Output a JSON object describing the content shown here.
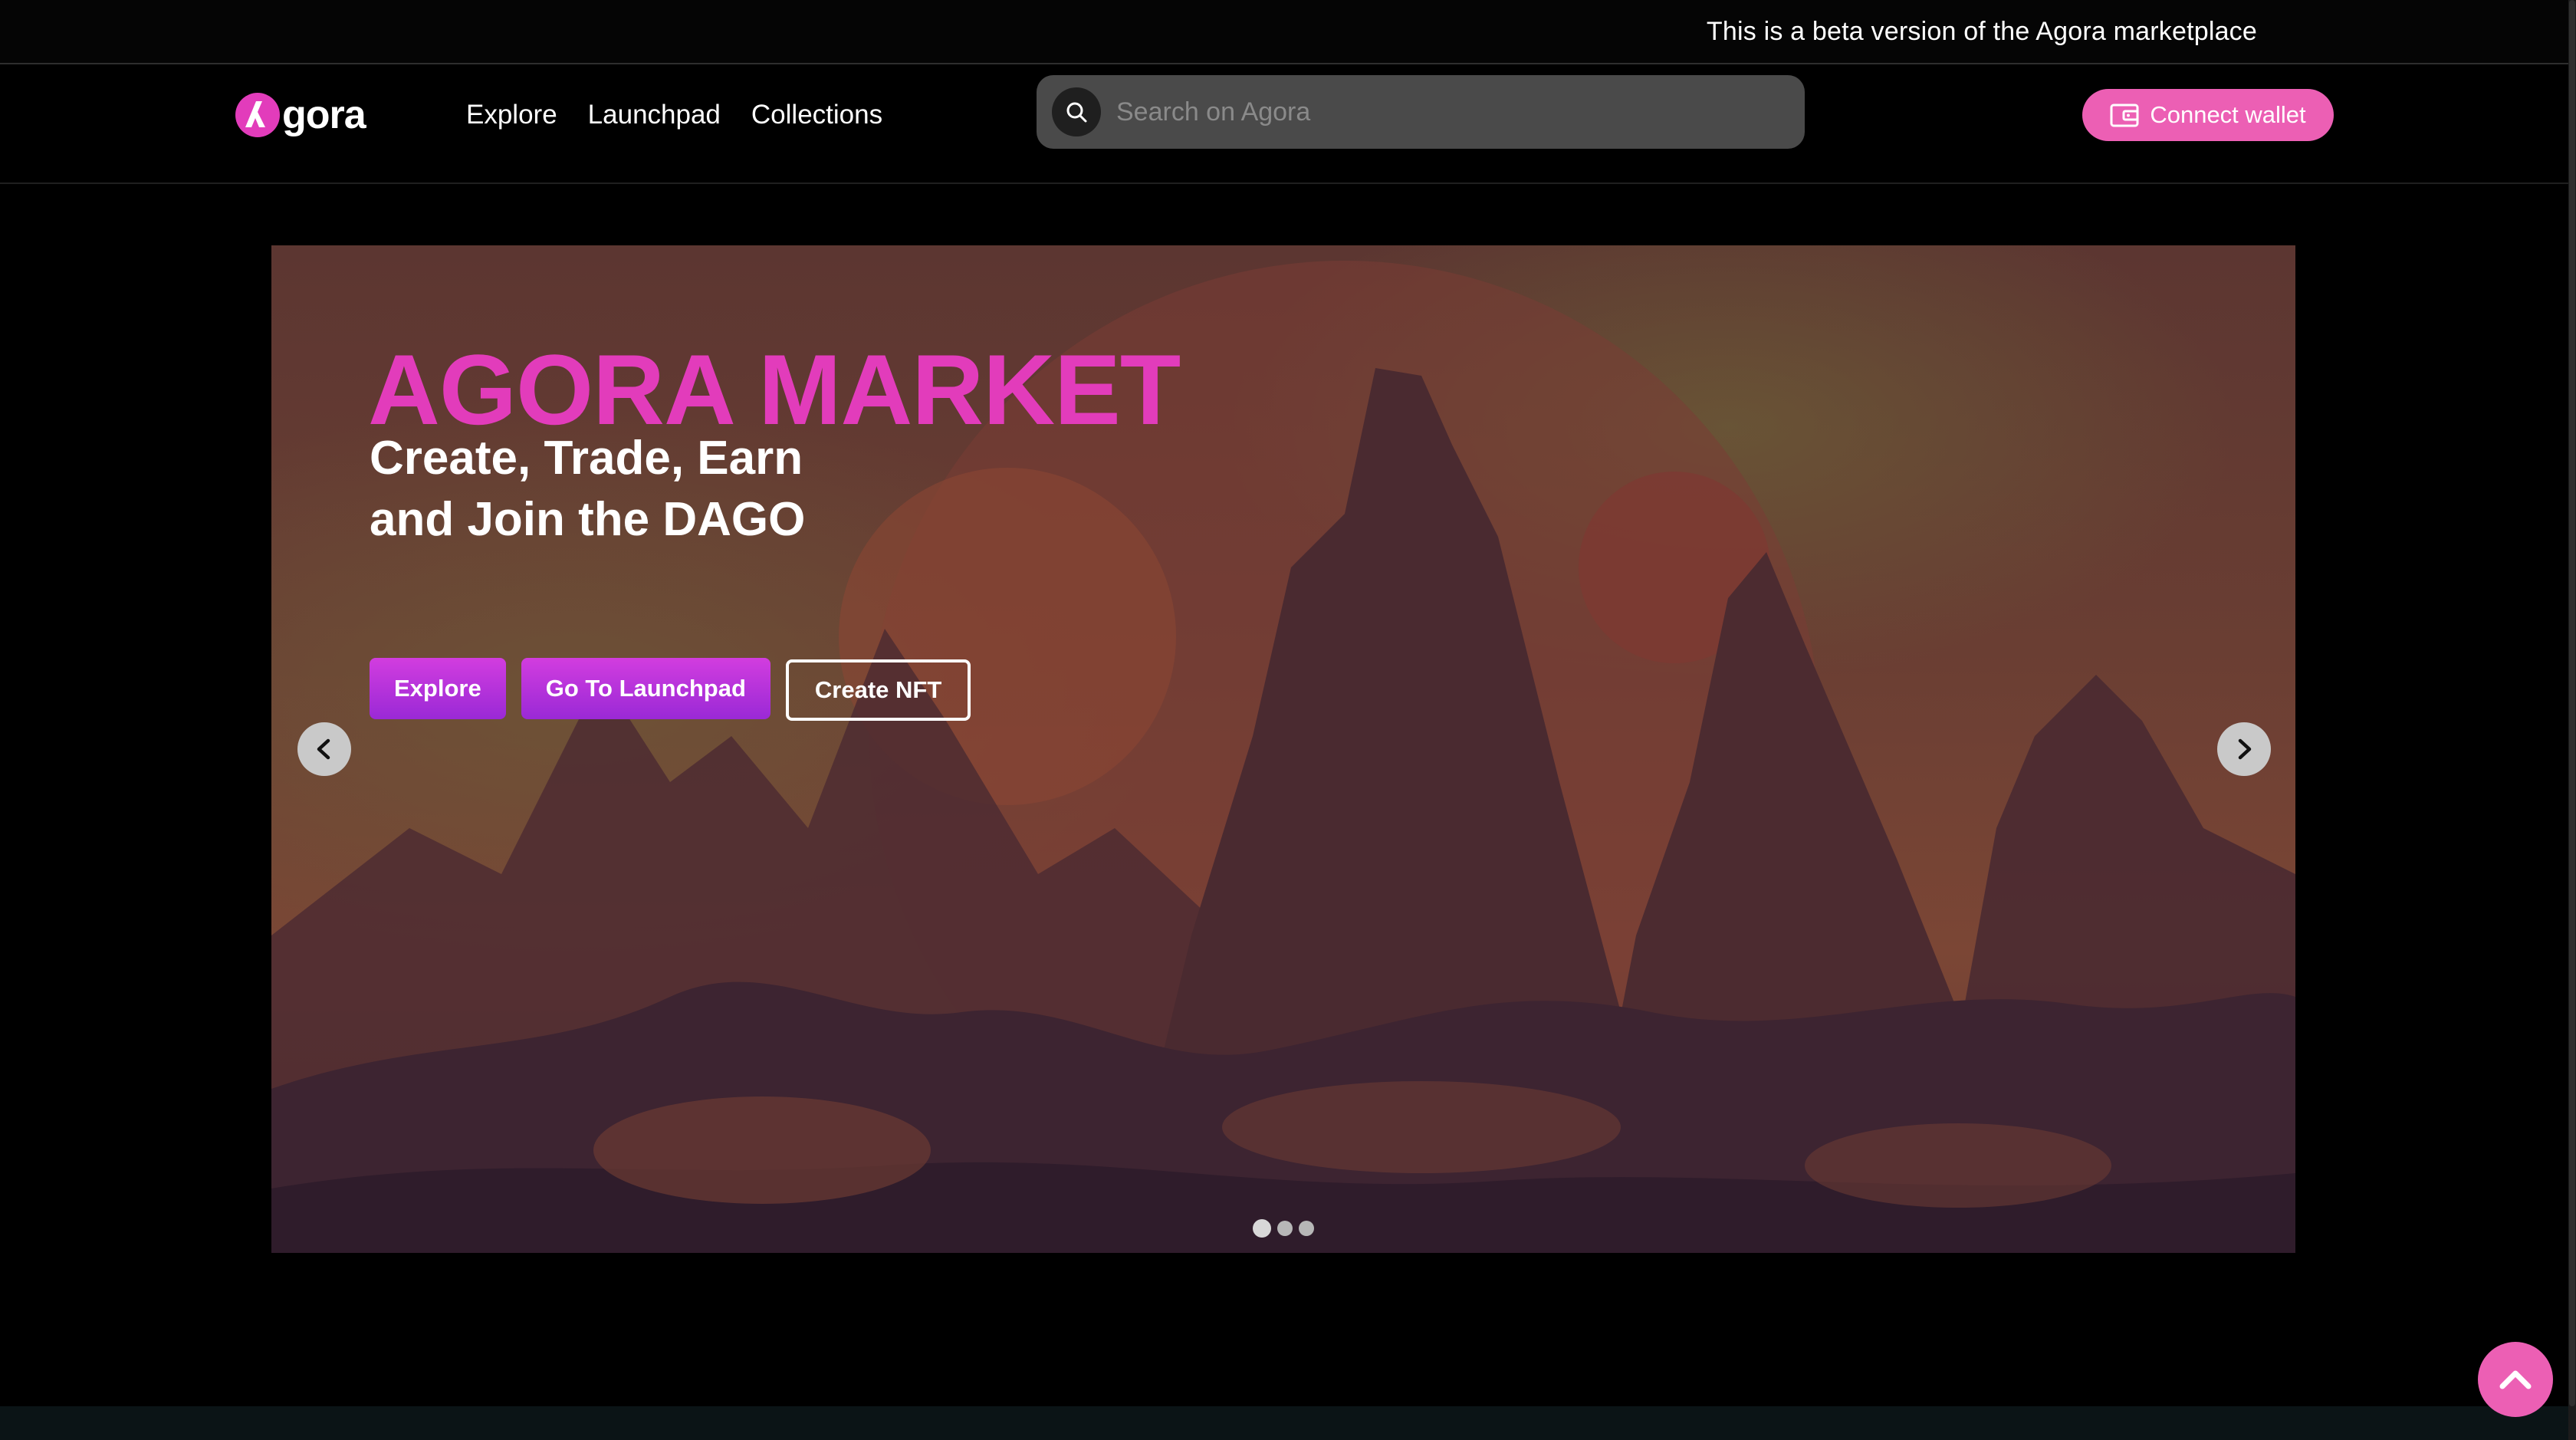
{
  "banner": {
    "text": "This is a beta version of the Agora marketplace"
  },
  "header": {
    "logo_text": "gora",
    "nav": [
      {
        "label": "Explore"
      },
      {
        "label": "Launchpad"
      },
      {
        "label": "Collections"
      }
    ],
    "search": {
      "placeholder": "Search on Agora",
      "value": ""
    },
    "connect_wallet_label": "Connect wallet"
  },
  "hero": {
    "title": "AGORA MARKET",
    "subtitle_line1": "Create, Trade, Earn",
    "subtitle_line2": "and Join the DAGO",
    "buttons": {
      "explore": "Explore",
      "launchpad": "Go To Launchpad",
      "create_nft": "Create NFT"
    },
    "slides_total": 3,
    "active_slide": 1
  },
  "colors": {
    "accent_pink": "#ec5fb4",
    "title_magenta": "#e23cbb",
    "button_purple": "#b333da",
    "background": "#000000",
    "search_bg": "#4a4a4a"
  },
  "icons": {
    "logo": "agora-logo-icon",
    "search": "search-icon",
    "wallet": "wallet-icon",
    "prev": "chevron-left-icon",
    "next": "chevron-right-icon",
    "scroll_top": "chevron-up-icon"
  }
}
